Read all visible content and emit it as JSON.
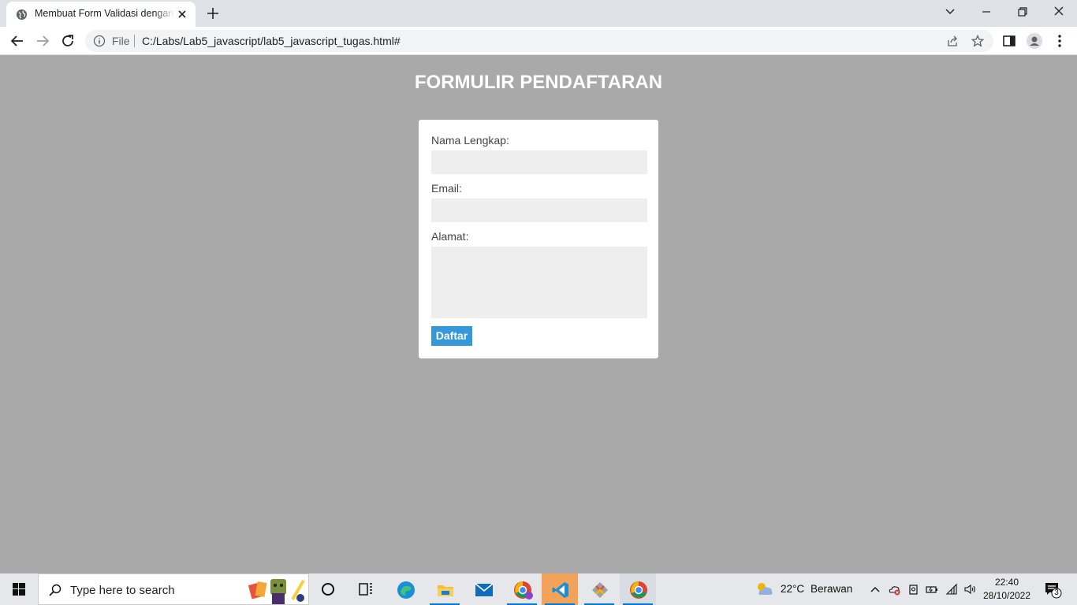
{
  "browser": {
    "tab_title": "Membuat Form Validasi dengan JavaScript",
    "url_scheme_label": "File",
    "url": "C:/Labs/Lab5_javascript/lab5_javascript_tugas.html#"
  },
  "page": {
    "title": "FORMULIR PENDAFTARAN",
    "form": {
      "name_label": "Nama Lengkap:",
      "name_value": "",
      "email_label": "Email:",
      "email_value": "",
      "address_label": "Alamat:",
      "address_value": "",
      "submit_label": "Daftar"
    }
  },
  "taskbar": {
    "search_placeholder": "Type here to search",
    "weather_temp": "22°C",
    "weather_desc": "Berawan",
    "time": "22:40",
    "date": "28/10/2022",
    "notification_count": "3"
  },
  "colors": {
    "page_background": "#a9a9a9",
    "button": "#3498db",
    "field": "#eeeeee"
  }
}
